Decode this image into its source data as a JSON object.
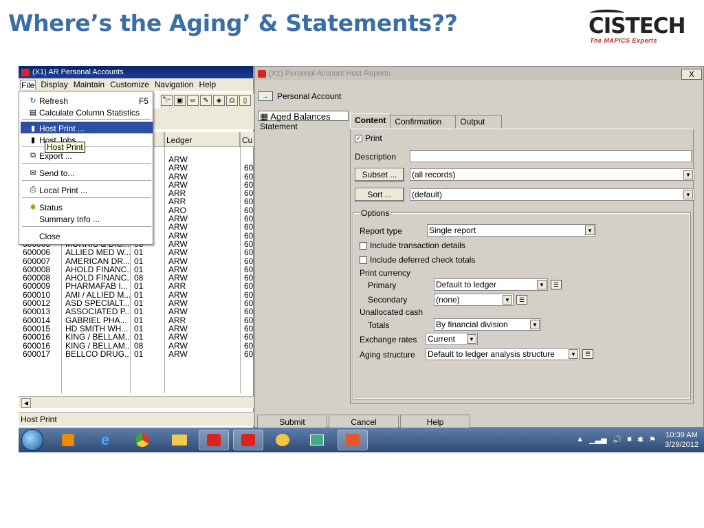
{
  "slide": {
    "title": "Where’s the Aging’ & Statements??"
  },
  "logo": {
    "word": "CISTECH",
    "tagline": "The MAPICS Experts"
  },
  "left_window": {
    "title": "(X1) AR Personal Accounts",
    "menu": [
      "File",
      "Display",
      "Maintain",
      "Customize",
      "Navigation",
      "Help"
    ],
    "toolbar_icons": [
      "binoculars-icon",
      "select-icon",
      "link-icon",
      "note-icon",
      "lock-icon",
      "print-icon",
      "page-icon"
    ],
    "columns": [
      "Ledger",
      "Cu"
    ],
    "status": "Host Print",
    "rows": [
      {
        "acct": "",
        "name": "",
        "div": "",
        "ledger": "ARW",
        "cu": ""
      },
      {
        "acct": "",
        "name": "",
        "div": "",
        "ledger": "ARW",
        "cu": "60"
      },
      {
        "acct": "",
        "name": "",
        "div": "",
        "ledger": "ARW",
        "cu": "60"
      },
      {
        "acct": "",
        "name": "",
        "div": "",
        "ledger": "ARW",
        "cu": "60"
      },
      {
        "acct": "",
        "name": "",
        "div": "",
        "ledger": "ARR",
        "cu": "60"
      },
      {
        "acct": "",
        "name": "",
        "div": "",
        "ledger": "ARR",
        "cu": "60"
      },
      {
        "acct": "",
        "name": "",
        "div": "",
        "ledger": "ARO",
        "cu": "60"
      },
      {
        "acct": "",
        "name": "",
        "div": "",
        "ledger": "ARW",
        "cu": "60"
      },
      {
        "acct": "",
        "name": "",
        "div": "",
        "ledger": "ARW",
        "cu": "60"
      },
      {
        "acct": "600005",
        "name": "MORRIS & DIC...",
        "div": "07",
        "ledger": "ARW",
        "cu": "60"
      },
      {
        "acct": "600005",
        "name": "MORRIS & DIC...",
        "div": "08",
        "ledger": "ARW",
        "cu": "60"
      },
      {
        "acct": "600006",
        "name": "ALLIED MED W...",
        "div": "01",
        "ledger": "ARW",
        "cu": "60"
      },
      {
        "acct": "600007",
        "name": "AMERICAN DR...",
        "div": "01",
        "ledger": "ARW",
        "cu": "60"
      },
      {
        "acct": "600008",
        "name": "AHOLD FINANC...",
        "div": "01",
        "ledger": "ARW",
        "cu": "60"
      },
      {
        "acct": "600008",
        "name": "AHOLD FINANC...",
        "div": "08",
        "ledger": "ARW",
        "cu": "60"
      },
      {
        "acct": "600009",
        "name": "PHARMAFAB I...",
        "div": "01",
        "ledger": "ARR",
        "cu": "60"
      },
      {
        "acct": "600010",
        "name": "AMI / ALLIED M...",
        "div": "01",
        "ledger": "ARW",
        "cu": "60"
      },
      {
        "acct": "600012",
        "name": "ASD SPECIALT...",
        "div": "01",
        "ledger": "ARW",
        "cu": "60"
      },
      {
        "acct": "600013",
        "name": "ASSOCIATED P...",
        "div": "01",
        "ledger": "ARW",
        "cu": "60"
      },
      {
        "acct": "600014",
        "name": "GABRIEL PHA...",
        "div": "01",
        "ledger": "ARR",
        "cu": "60"
      },
      {
        "acct": "600015",
        "name": "HD SMITH WH...",
        "div": "01",
        "ledger": "ARW",
        "cu": "60"
      },
      {
        "acct": "600016",
        "name": "KING / BELLAM...",
        "div": "01",
        "ledger": "ARW",
        "cu": "60"
      },
      {
        "acct": "600016",
        "name": "KING / BELLAM...",
        "div": "08",
        "ledger": "ARW",
        "cu": "60"
      },
      {
        "acct": "600017",
        "name": "BELLCO DRUG...",
        "div": "01",
        "ledger": "ARW",
        "cu": "60"
      }
    ]
  },
  "file_menu": {
    "refresh": "Refresh",
    "refresh_shortcut": "F5",
    "calc_stats": "Calculate Column Statistics",
    "host_print": "Host Print ...",
    "host_jobs": "Host Jobs",
    "tooltip": "Host Print",
    "export": "Export ...",
    "send_to": "Send to...",
    "local_print": "Local Print ...",
    "status": "Status",
    "summary_info": "Summary Info ...",
    "close": "Close"
  },
  "right_window": {
    "title": "(X1) Personal Account Host Reports",
    "close": "X",
    "header": "Personal Account",
    "nav": [
      "Aged Balances",
      "Statement"
    ],
    "tabs": [
      "Content",
      "Confirmation",
      "Output"
    ],
    "print_label": "Print",
    "print_checked": true,
    "description_label": "Description",
    "description_value": "",
    "subset_button": "Subset ...",
    "subset_value": "(all records)",
    "sort_button": "Sort ...",
    "sort_value": "(default)",
    "options_label": "Options",
    "report_type_label": "Report type",
    "report_type_value": "Single report",
    "include_txn": "Include transaction details",
    "include_deferred": "Include deferred check totals",
    "print_currency_label": "Print currency",
    "primary_label": "Primary",
    "primary_value": "Default to ledger",
    "secondary_label": "Secondary",
    "secondary_value": "(none)",
    "unallocated_label": "Unallocated cash",
    "totals_label": "Totals",
    "totals_value": "By financial division",
    "exchange_label": "Exchange rates",
    "exchange_value": "Current",
    "aging_label": "Aging structure",
    "aging_value": "Default to ledger analysis structure",
    "buttons": [
      "Submit",
      "Cancel",
      "Help"
    ]
  },
  "taskbar": {
    "time": "10:39 AM",
    "date": "3/29/2012"
  }
}
